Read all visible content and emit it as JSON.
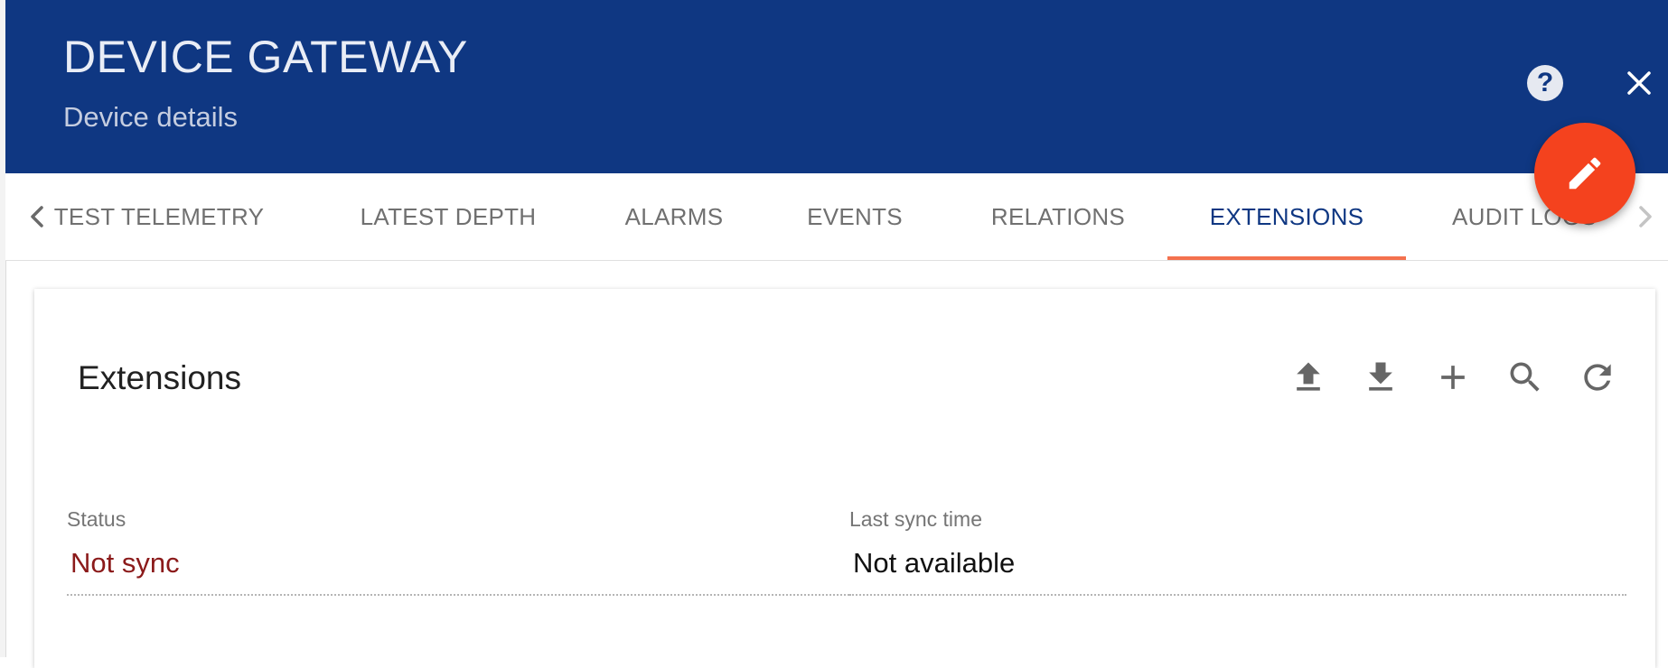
{
  "header": {
    "title": "DEVICE GATEWAY",
    "subtitle": "Device details",
    "help_icon": "help-circle-icon",
    "close_icon": "close-icon",
    "edit_icon": "pencil-icon",
    "colors": {
      "background": "#0f3782",
      "fab": "#f4421e"
    }
  },
  "tabs": {
    "items": [
      {
        "label": "TEST TELEMETRY"
      },
      {
        "label": "LATEST DEPTH"
      },
      {
        "label": "ALARMS"
      },
      {
        "label": "EVENTS"
      },
      {
        "label": "RELATIONS"
      },
      {
        "label": "EXTENSIONS",
        "active": true
      },
      {
        "label": "AUDIT LOGS"
      }
    ],
    "active_index": 5,
    "indicator_color": "#f4714e",
    "prev_icon": "chevron-left-icon",
    "next_icon": "chevron-right-icon"
  },
  "extensions": {
    "title": "Extensions",
    "toolbar": [
      "upload-icon",
      "download-icon",
      "add-icon",
      "search-icon",
      "refresh-icon"
    ],
    "status": {
      "label": "Status",
      "value": "Not sync",
      "color": "#8b1a1a"
    },
    "last_sync": {
      "label": "Last sync time",
      "value": "Not available"
    }
  }
}
